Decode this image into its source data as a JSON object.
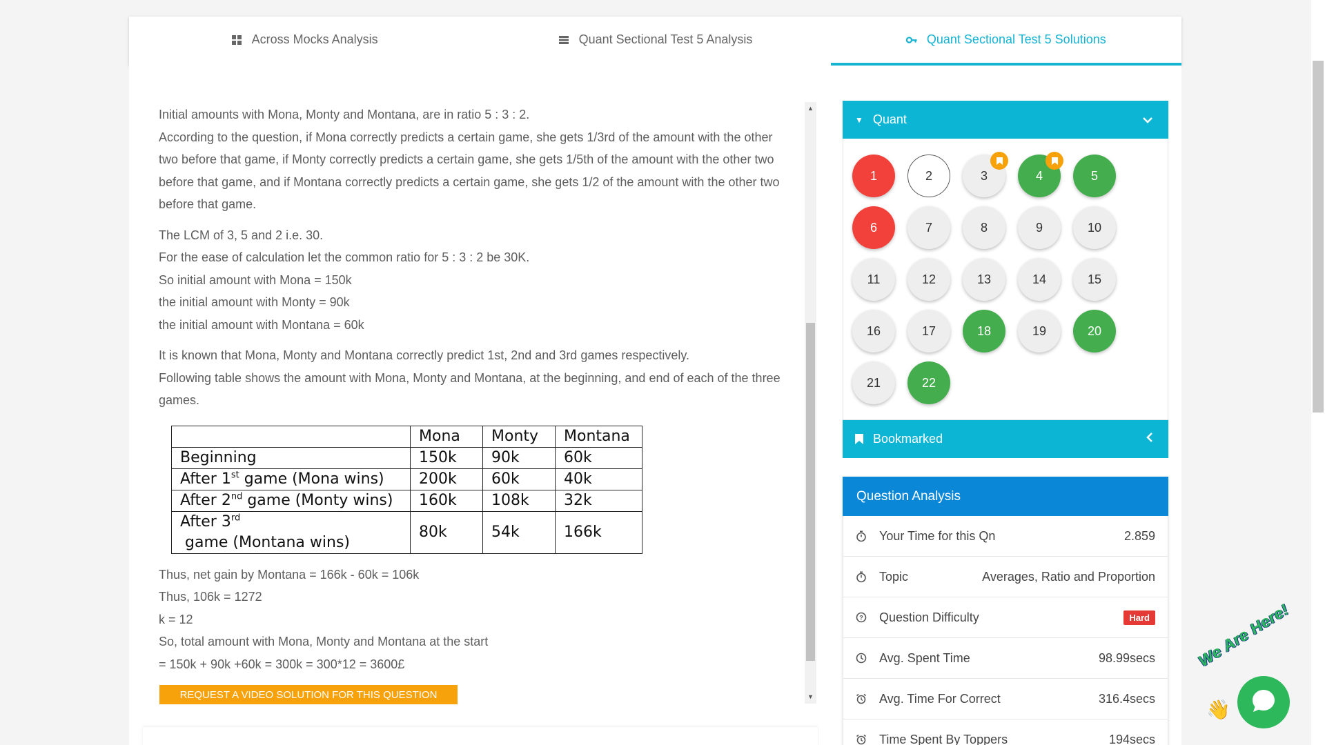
{
  "tabs": [
    {
      "label": "Across Mocks Analysis",
      "icon": "grid-icon"
    },
    {
      "label": "Quant Sectional Test 5 Analysis",
      "icon": "list-icon"
    },
    {
      "label": "Quant Sectional Test 5 Solutions",
      "icon": "key-icon"
    }
  ],
  "solution": {
    "p1_lines": [
      "Initial amounts with Mona, Monty and Montana, are in ratio 5 : 3 : 2.",
      "According to the question, if Mona correctly predicts a certain game, she gets 1/3rd of the amount with the other two before that game, if Monty correctly predicts a certain game, she gets 1/5th of the amount with the other two before that game, and if Montana correctly predicts a certain game, she gets 1/2 of the amount with the other two before that game."
    ],
    "p2_lines": [
      "The LCM of 3, 5 and 2 i.e. 30.",
      "For the ease of calculation let the common ratio for 5 : 3 : 2 be 30K.",
      "So initial amount with Mona = 150k",
      "the initial amount with Monty = 90k",
      "the initial amount with Montana = 60k"
    ],
    "p3_lines": [
      "It is known that Mona, Monty and Montana correctly predict 1st, 2nd and 3rd games respectively.",
      "Following table shows the amount with Mona, Monty and Montana, at the beginning, and end of each of the three games."
    ],
    "table": {
      "headers": [
        "",
        "Mona",
        "Monty",
        "Montana"
      ],
      "rows": [
        {
          "pre": "Beginning",
          "sup": "",
          "post": "",
          "mona": "150k",
          "monty": "90k",
          "montana": "60k"
        },
        {
          "pre": "After 1",
          "sup": "st",
          "post": " game (Mona wins)",
          "mona": "200k",
          "monty": "60k",
          "montana": "40k"
        },
        {
          "pre": "After 2",
          "sup": "nd",
          "post": " game (Monty wins)",
          "mona": "160k",
          "monty": "108k",
          "montana": "32k"
        },
        {
          "pre": "After 3",
          "sup": "rd",
          "post": " game (Montana wins)",
          "mona": "80k",
          "monty": "54k",
          "montana": "166k"
        }
      ]
    },
    "p4_lines": [
      "Thus, net gain by Montana = 166k - 60k = 106k",
      "Thus, 106k = 1272",
      "k = 12",
      "So, total amount with Mona, Monty and Montana at the start",
      "= 150k + 90k +60k = 300k = 300*12 = 3600£"
    ],
    "video_button": "REQUEST A VIDEO SOLUTION FOR THIS QUESTION"
  },
  "quant_section": {
    "title": "Quant",
    "questions": [
      {
        "n": "1",
        "state": "red",
        "bookmarked": false
      },
      {
        "n": "2",
        "state": "outline",
        "bookmarked": false
      },
      {
        "n": "3",
        "state": "grey",
        "bookmarked": true
      },
      {
        "n": "4",
        "state": "green",
        "bookmarked": true
      },
      {
        "n": "5",
        "state": "green",
        "bookmarked": false
      },
      {
        "n": "6",
        "state": "red",
        "bookmarked": false
      },
      {
        "n": "7",
        "state": "grey",
        "bookmarked": false
      },
      {
        "n": "8",
        "state": "grey",
        "bookmarked": false
      },
      {
        "n": "9",
        "state": "grey",
        "bookmarked": false
      },
      {
        "n": "10",
        "state": "grey",
        "bookmarked": false
      },
      {
        "n": "11",
        "state": "grey",
        "bookmarked": false
      },
      {
        "n": "12",
        "state": "grey",
        "bookmarked": false
      },
      {
        "n": "13",
        "state": "grey",
        "bookmarked": false
      },
      {
        "n": "14",
        "state": "grey",
        "bookmarked": false
      },
      {
        "n": "15",
        "state": "grey",
        "bookmarked": false
      },
      {
        "n": "16",
        "state": "grey",
        "bookmarked": false
      },
      {
        "n": "17",
        "state": "grey",
        "bookmarked": false
      },
      {
        "n": "18",
        "state": "green",
        "bookmarked": false
      },
      {
        "n": "19",
        "state": "grey",
        "bookmarked": false
      },
      {
        "n": "20",
        "state": "green",
        "bookmarked": false
      },
      {
        "n": "21",
        "state": "grey",
        "bookmarked": false
      },
      {
        "n": "22",
        "state": "green",
        "bookmarked": false
      }
    ]
  },
  "bookmarked_section": {
    "title": "Bookmarked"
  },
  "question_analysis": {
    "title": "Question Analysis",
    "rows": [
      {
        "icon": "stopwatch-icon",
        "label": "Your Time for this Qn",
        "value": "2.859"
      },
      {
        "icon": "stopwatch-icon",
        "label": "Topic",
        "value": "Averages, Ratio and Proportion"
      },
      {
        "icon": "help-circle-icon",
        "label": "Question Difficulty",
        "badge": "Hard"
      },
      {
        "icon": "clock-icon",
        "label": "Avg. Spent Time",
        "value": "98.99secs"
      },
      {
        "icon": "alarm-icon",
        "label": "Avg. Time For Correct",
        "value": "316.4secs"
      },
      {
        "icon": "alarm-icon",
        "label": "Time Spent By Toppers",
        "value": "194secs"
      }
    ]
  },
  "chat_widget": {
    "tagline": "We Are Here!"
  },
  "colors": {
    "accent": "#0bb5d3",
    "analysis_header": "#0b87d8",
    "correct": "#44ad4d",
    "wrong": "#f2413a",
    "bookmark": "#f7a10b",
    "badge_hard": "#e53935"
  }
}
